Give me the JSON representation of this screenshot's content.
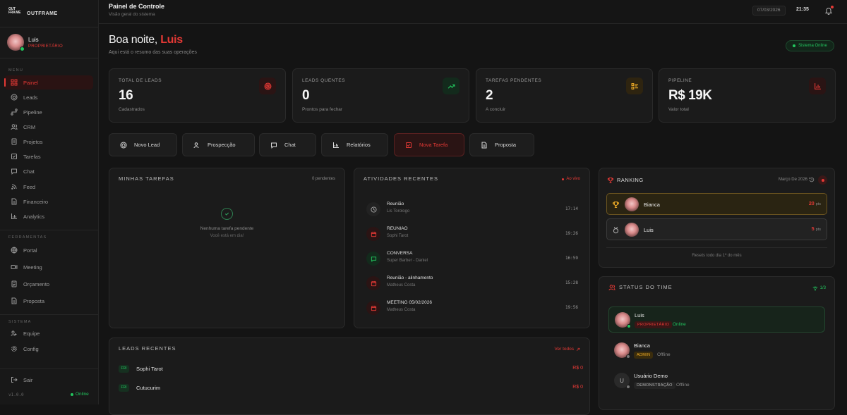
{
  "brand": {
    "mark": "OUT FRA ME",
    "name": "OUTFRAME"
  },
  "user": {
    "name": "Luis",
    "role": "PROPRIETÁRIO"
  },
  "sidebar": {
    "menu_label": "MENU",
    "menu": [
      {
        "label": "Painel",
        "icon": "grid-icon"
      },
      {
        "label": "Leads",
        "icon": "target-icon"
      },
      {
        "label": "Pipeline",
        "icon": "route-icon"
      },
      {
        "label": "CRM",
        "icon": "users-icon"
      },
      {
        "label": "Projetos",
        "icon": "folder-icon"
      },
      {
        "label": "Tarefas",
        "icon": "checklist-icon"
      },
      {
        "label": "Chat",
        "icon": "chat-icon"
      },
      {
        "label": "Feed",
        "icon": "rss-icon"
      },
      {
        "label": "Financeiro",
        "icon": "document-icon"
      },
      {
        "label": "Analytics",
        "icon": "bar-chart-icon"
      }
    ],
    "tools_label": "FERRAMENTAS",
    "tools": [
      {
        "label": "Portal",
        "icon": "globe-icon"
      },
      {
        "label": "Meeting",
        "icon": "video-icon"
      },
      {
        "label": "Orçamento",
        "icon": "document-icon"
      },
      {
        "label": "Proposta",
        "icon": "document-icon"
      }
    ],
    "system_label": "SISTEMA",
    "system": [
      {
        "label": "Equipe",
        "icon": "team-icon"
      },
      {
        "label": "Config",
        "icon": "gear-icon"
      }
    ],
    "logout": "Sair",
    "version": "v1.0.0",
    "status": "Online"
  },
  "topbar": {
    "title": "Painel de Controle",
    "subtitle": "Visão geral do sistema",
    "date": "07/03/2026",
    "time": "21:35"
  },
  "greeting": {
    "prefix": "Boa noite, ",
    "name": "Luis",
    "subtitle": "Aqui está o resumo das suas operações",
    "system_status": "Sistema Online"
  },
  "stats": [
    {
      "label": "TOTAL DE LEADS",
      "value": "16",
      "sub": "Cadastrados",
      "color": "#e53935"
    },
    {
      "label": "LEADS QUENTES",
      "value": "0",
      "sub": "Prontos para fechar",
      "color": "#22c55e"
    },
    {
      "label": "TAREFAS PENDENTES",
      "value": "2",
      "sub": "A concluir",
      "color": "#f5b027"
    },
    {
      "label": "PIPELINE",
      "value": "R$ 19K",
      "sub": "Valor total",
      "color": "#e53935"
    }
  ],
  "quick_actions": [
    "Novo Lead",
    "Prospecção",
    "Chat",
    "Relatórios",
    "Nova Tarefa",
    "Proposta"
  ],
  "tasks": {
    "title": "MINHAS TAREFAS",
    "count": "0 pendentes",
    "empty": "Nenhuma tarefa pendente",
    "empty_sub": "Você está em dia!"
  },
  "activities": {
    "title": "ATIVIDADES RECENTES",
    "live": "Ao vivo",
    "items": [
      {
        "title": "Reunião",
        "sub": "Lis Torologo",
        "time": "17:14",
        "kind": "clock"
      },
      {
        "title": "REUNIAO",
        "sub": "Sophi Tarot",
        "time": "19:26",
        "kind": "calendar"
      },
      {
        "title": "CONVERSA",
        "sub": "Super Barber - Daniel",
        "time": "16:59",
        "kind": "chat"
      },
      {
        "title": "Reunião - alinhamento",
        "sub": "Matheus Costa",
        "time": "15:28",
        "kind": "calendar"
      },
      {
        "title": "MEETING 05/02/2026",
        "sub": "Matheus Costa",
        "time": "19:56",
        "kind": "calendar"
      }
    ]
  },
  "ranking": {
    "title": "RANKING",
    "period": "Março De 2026",
    "items": [
      {
        "name": "Bianca",
        "points": "20",
        "unit": "pts"
      },
      {
        "name": "Luis",
        "points": "5",
        "unit": "pts"
      }
    ],
    "note": "Resets todo dia 1º do mês"
  },
  "team": {
    "title": "STATUS DO TIME",
    "count": "1/3",
    "members": [
      {
        "name": "Luis",
        "badge": "PROPRIETÁRIO",
        "status": "Online"
      },
      {
        "name": "Bianca",
        "badge": "ADMIN",
        "status": "Offline"
      },
      {
        "name": "Usuário Demo",
        "initial": "U",
        "badge": "DEMONSTRAÇÃO",
        "status": "Offline"
      }
    ]
  },
  "leads": {
    "title": "LEADS RECENTES",
    "view_all": "Ver todos",
    "items": [
      {
        "badge": "FRI",
        "name": "Sophi Tarot",
        "value": "R$ 0"
      },
      {
        "badge": "FRI",
        "name": "Cutucurim",
        "value": "R$ 0"
      }
    ]
  }
}
